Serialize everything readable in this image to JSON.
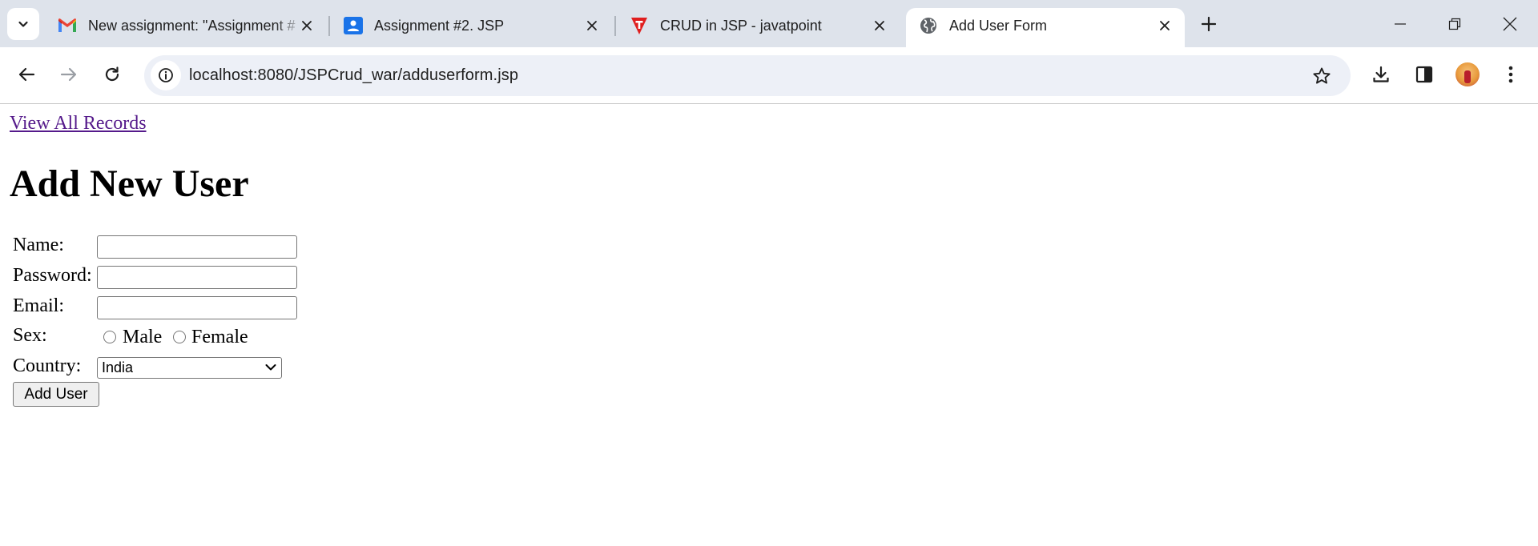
{
  "browser": {
    "tabs": [
      {
        "title": "New assignment: \"Assignment #",
        "icon": "gmail-icon",
        "active": false
      },
      {
        "title": "Assignment #2. JSP",
        "icon": "classroom-icon",
        "active": false
      },
      {
        "title": "CRUD in JSP - javatpoint",
        "icon": "javatpoint-icon",
        "active": false
      },
      {
        "title": "Add User Form",
        "icon": "globe-icon",
        "active": true
      }
    ],
    "url": "localhost:8080/JSPCrud_war/adduserform.jsp"
  },
  "page": {
    "view_link": "View All Records",
    "heading": "Add New User",
    "form": {
      "name_label": "Name:",
      "password_label": "Password:",
      "email_label": "Email:",
      "sex_label": "Sex:",
      "sex_options": [
        "Male",
        "Female"
      ],
      "country_label": "Country:",
      "country_value": "India",
      "submit_label": "Add User"
    }
  },
  "colors": {
    "tabstrip_bg": "#dee3eb",
    "omnibox_bg": "#edf0f7",
    "visited_link": "#551a8b"
  }
}
